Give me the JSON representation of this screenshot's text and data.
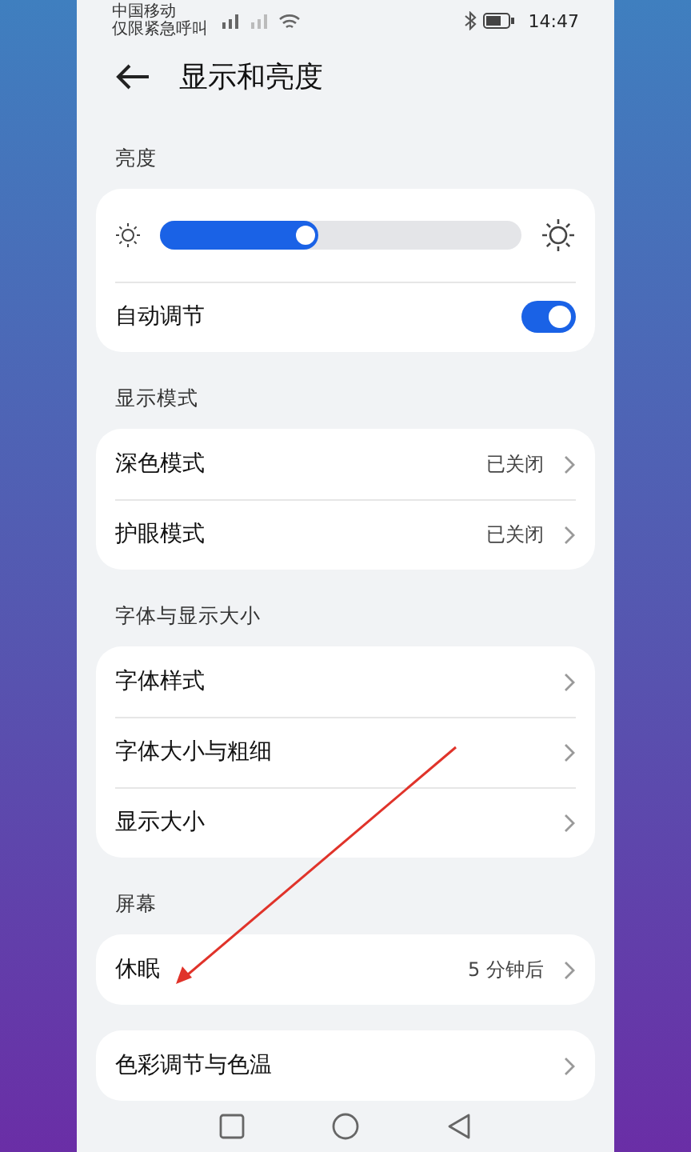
{
  "status_bar": {
    "carrier": "中国移动",
    "carrier_note": "仅限紧急呼叫",
    "time": "14:47"
  },
  "header": {
    "title": "显示和亮度"
  },
  "sections": [
    {
      "title": "亮度",
      "items": [
        {
          "kind": "slider",
          "level": 0.44
        },
        {
          "kind": "switch",
          "label": "自动调节",
          "on": true
        }
      ]
    },
    {
      "title": "显示模式",
      "items": [
        {
          "kind": "link",
          "label": "深色模式",
          "value": "已关闭"
        },
        {
          "kind": "link",
          "label": "护眼模式",
          "value": "已关闭"
        }
      ]
    },
    {
      "title": "字体与显示大小",
      "items": [
        {
          "kind": "link",
          "label": "字体样式"
        },
        {
          "kind": "link",
          "label": "字体大小与粗细"
        },
        {
          "kind": "link",
          "label": "显示大小"
        }
      ]
    },
    {
      "title": "屏幕",
      "items": [
        {
          "kind": "link",
          "label": "休眠",
          "value": "5 分钟后"
        }
      ]
    },
    {
      "items": [
        {
          "kind": "link",
          "label": "色彩调节与色温"
        }
      ]
    }
  ]
}
